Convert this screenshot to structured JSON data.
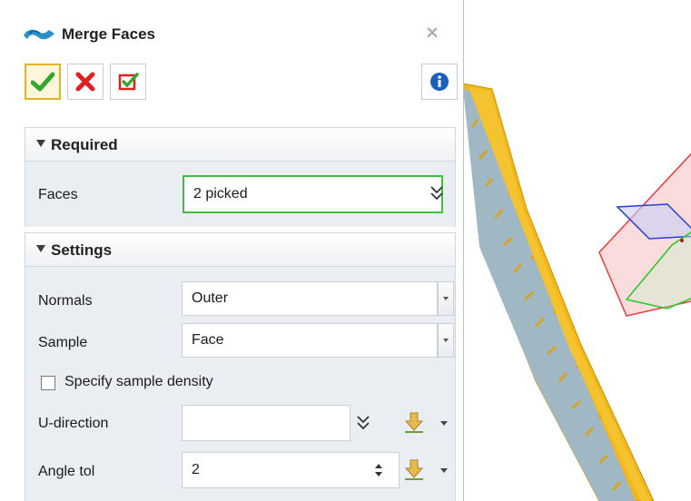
{
  "panel": {
    "title": "Merge Faces",
    "toolbar": {
      "ok_icon": "checkmark-icon",
      "cancel_icon": "x-icon",
      "apply_icon": "apply-check-icon",
      "info_icon": "info-icon"
    }
  },
  "required": {
    "header": "Required",
    "faces_label": "Faces",
    "faces_value": "2 picked"
  },
  "settings": {
    "header": "Settings",
    "normals_label": "Normals",
    "normals_value": "Outer",
    "sample_label": "Sample",
    "sample_value": "Face",
    "density_label": "Specify sample density",
    "density_checked": false,
    "udir_label": "U-direction",
    "udir_value": "",
    "angle_label": "Angle tol",
    "angle_value": "2"
  },
  "colors": {
    "accent_green": "#3fbf3f",
    "part_gold": "#f2b81a",
    "part_steel": "#9fb8c4",
    "plane_red": "#e63c3c",
    "plane_blue": "#2a3cd8",
    "plane_green": "#28c828"
  }
}
